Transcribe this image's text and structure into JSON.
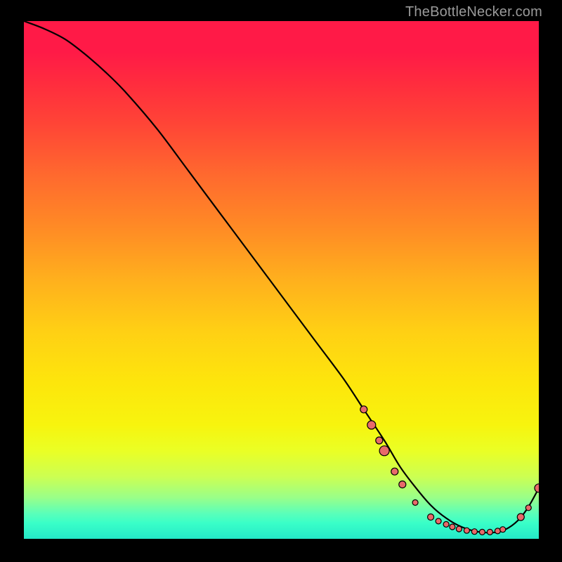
{
  "watermark": "TheBottleNecker.com",
  "chart_data": {
    "type": "line",
    "title": "",
    "xlabel": "",
    "ylabel": "",
    "xlim": [
      0,
      100
    ],
    "ylim": [
      0,
      100
    ],
    "grid": false,
    "legend": false,
    "series": [
      {
        "name": "bottleneck-curve",
        "x": [
          0,
          4,
          8,
          12,
          16,
          20,
          26,
          32,
          38,
          44,
          50,
          56,
          62,
          66,
          70,
          73,
          76,
          79,
          82,
          85,
          88,
          91,
          93.5,
          96,
          98,
          100
        ],
        "y": [
          100,
          98.5,
          96.5,
          93.5,
          90,
          86,
          79,
          71,
          63,
          55,
          47,
          39,
          31,
          25,
          19,
          14,
          10,
          6.5,
          4,
          2.3,
          1.4,
          1.2,
          1.8,
          3.6,
          6.2,
          9.8
        ]
      }
    ],
    "marker_points": {
      "name": "highlight-dots",
      "points": [
        {
          "x": 66,
          "y": 25,
          "r": 5
        },
        {
          "x": 67.5,
          "y": 22,
          "r": 6
        },
        {
          "x": 69,
          "y": 19,
          "r": 5
        },
        {
          "x": 70,
          "y": 17,
          "r": 7
        },
        {
          "x": 72,
          "y": 13,
          "r": 5
        },
        {
          "x": 73.5,
          "y": 10.5,
          "r": 5
        },
        {
          "x": 76,
          "y": 7,
          "r": 4
        },
        {
          "x": 79,
          "y": 4.2,
          "r": 4.5
        },
        {
          "x": 80.5,
          "y": 3.4,
          "r": 4
        },
        {
          "x": 82,
          "y": 2.8,
          "r": 4
        },
        {
          "x": 83.2,
          "y": 2.3,
          "r": 4
        },
        {
          "x": 84.5,
          "y": 1.9,
          "r": 4
        },
        {
          "x": 86,
          "y": 1.6,
          "r": 4
        },
        {
          "x": 87.5,
          "y": 1.4,
          "r": 4
        },
        {
          "x": 89,
          "y": 1.3,
          "r": 4
        },
        {
          "x": 90.5,
          "y": 1.3,
          "r": 4
        },
        {
          "x": 92,
          "y": 1.5,
          "r": 4
        },
        {
          "x": 93,
          "y": 1.8,
          "r": 4
        },
        {
          "x": 96.5,
          "y": 4.2,
          "r": 5
        },
        {
          "x": 98,
          "y": 6.0,
          "r": 4
        },
        {
          "x": 100,
          "y": 9.8,
          "r": 6
        }
      ]
    }
  }
}
